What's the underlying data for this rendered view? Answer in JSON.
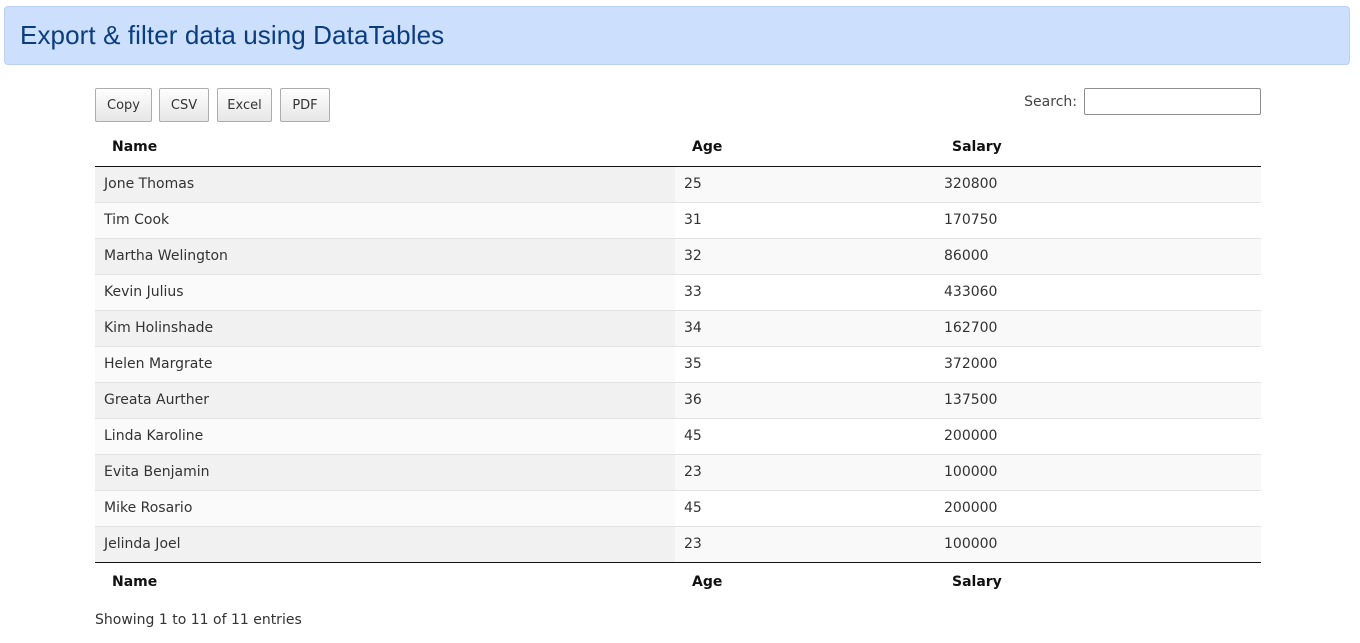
{
  "header": {
    "title": "Export & filter data using DataTables"
  },
  "toolbar": {
    "buttons": [
      "Copy",
      "CSV",
      "Excel",
      "PDF"
    ]
  },
  "search": {
    "label": "Search:",
    "value": ""
  },
  "table": {
    "columns": [
      "Name",
      "Age",
      "Salary"
    ],
    "rows": [
      [
        "Jone Thomas",
        "25",
        "320800"
      ],
      [
        "Tim Cook",
        "31",
        "170750"
      ],
      [
        "Martha Welington",
        "32",
        "86000"
      ],
      [
        "Kevin Julius",
        "33",
        "433060"
      ],
      [
        "Kim Holinshade",
        "34",
        "162700"
      ],
      [
        "Helen Margrate",
        "35",
        "372000"
      ],
      [
        "Greata Aurther",
        "36",
        "137500"
      ],
      [
        "Linda Karoline",
        "45",
        "200000"
      ],
      [
        "Evita Benjamin",
        "23",
        "100000"
      ],
      [
        "Mike Rosario",
        "45",
        "200000"
      ],
      [
        "Jelinda Joel",
        "23",
        "100000"
      ]
    ]
  },
  "footer": {
    "info": "Showing 1 to 11 of 11 entries"
  }
}
